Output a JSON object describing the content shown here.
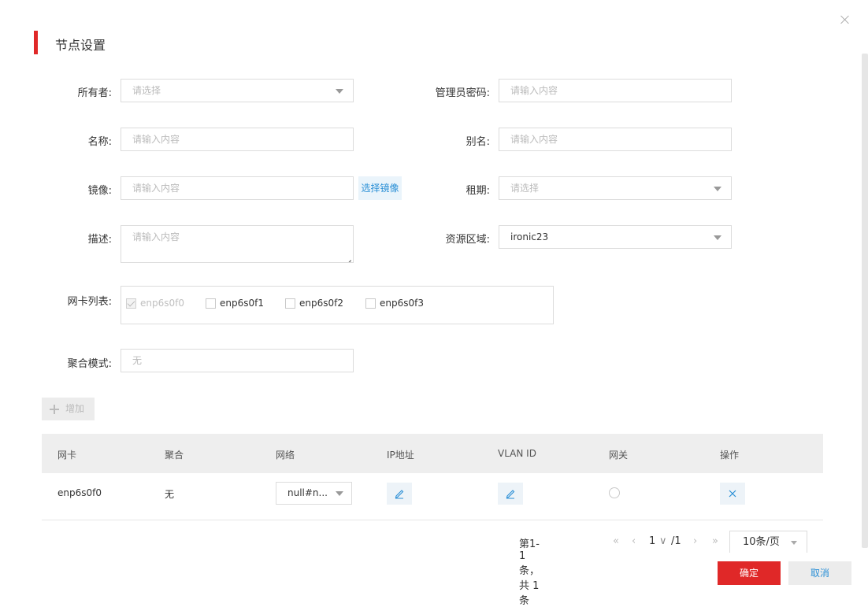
{
  "dialog": {
    "title": "节点设置"
  },
  "form": {
    "owner": {
      "label": "所有者:",
      "placeholder": "请选择"
    },
    "admin_password": {
      "label": "管理员密码:",
      "placeholder": "请输入内容"
    },
    "name": {
      "label": "名称:",
      "placeholder": "请输入内容"
    },
    "alias": {
      "label": "别名:",
      "placeholder": "请输入内容"
    },
    "image": {
      "label": "镜像:",
      "placeholder": "请输入内容",
      "select_button": "选择镜像"
    },
    "lease": {
      "label": "租期:",
      "placeholder": "请选择"
    },
    "description": {
      "label": "描述:",
      "placeholder": "请输入内容"
    },
    "resource_zone": {
      "label": "资源区域:",
      "value": "ironic23"
    },
    "nic_list": {
      "label": "网卡列表:",
      "items": [
        {
          "name": "enp6s0f0",
          "checked": true,
          "disabled": true
        },
        {
          "name": "enp6s0f1",
          "checked": false,
          "disabled": false
        },
        {
          "name": "enp6s0f2",
          "checked": false,
          "disabled": false
        },
        {
          "name": "enp6s0f3",
          "checked": false,
          "disabled": false
        }
      ]
    },
    "bond_mode": {
      "label": "聚合模式:",
      "placeholder": "无"
    }
  },
  "add_button": "增加",
  "table": {
    "headers": [
      "网卡",
      "聚合",
      "网络",
      "IP地址",
      "VLAN ID",
      "网关",
      "操作"
    ],
    "rows": [
      {
        "nic": "enp6s0f0",
        "bond": "无",
        "network": "null#n..."
      }
    ]
  },
  "pagination": {
    "summary": "第1-1条，共 1 条",
    "current_page": "1",
    "total_pages": "/1",
    "page_size": "10条/页"
  },
  "footer": {
    "confirm": "确定",
    "cancel": "取消"
  },
  "colors": {
    "accent": "#e02828",
    "link": "#2a8fd6"
  }
}
